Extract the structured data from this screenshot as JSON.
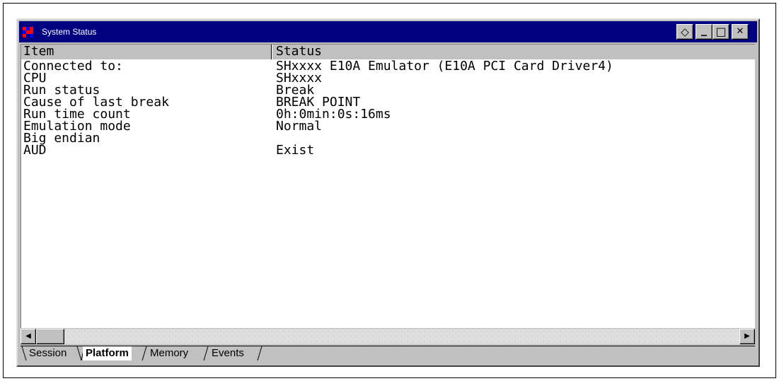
{
  "window": {
    "title": "System Status"
  },
  "titlebar_buttons": [
    {
      "name": "restore-pin-button",
      "glyph": "◇"
    },
    {
      "name": "minimize-button",
      "glyph": "_"
    },
    {
      "name": "maximize-button",
      "glyph": "□"
    },
    {
      "name": "close-button",
      "glyph": "✕"
    }
  ],
  "table": {
    "columns": [
      "Item",
      "Status"
    ],
    "rows": [
      {
        "item": "Connected to:",
        "status": "SHxxxx  E10A Emulator (E10A PCI Card Driver4)"
      },
      {
        "item": "CPU",
        "status": "SHxxxx"
      },
      {
        "item": "Run status",
        "status": "Break"
      },
      {
        "item": "Cause of last break",
        "status": "BREAK POINT"
      },
      {
        "item": "Run time count",
        "status": "0h:0min:0s:16ms"
      },
      {
        "item": "Emulation mode",
        "status": "Normal"
      },
      {
        "item": "Big endian",
        "status": ""
      },
      {
        "item": "AUD",
        "status": "Exist"
      }
    ]
  },
  "scrollbar": {
    "left_arrow": "◀",
    "right_arrow": "▶"
  },
  "tabs": [
    {
      "label": "Session",
      "active": false
    },
    {
      "label": "Platform",
      "active": true
    },
    {
      "label": "Memory",
      "active": false
    },
    {
      "label": "Events",
      "active": false
    }
  ],
  "colors": {
    "titlebar": "#000080",
    "face": "#c0c0c0",
    "content_bg": "#ffffff"
  }
}
